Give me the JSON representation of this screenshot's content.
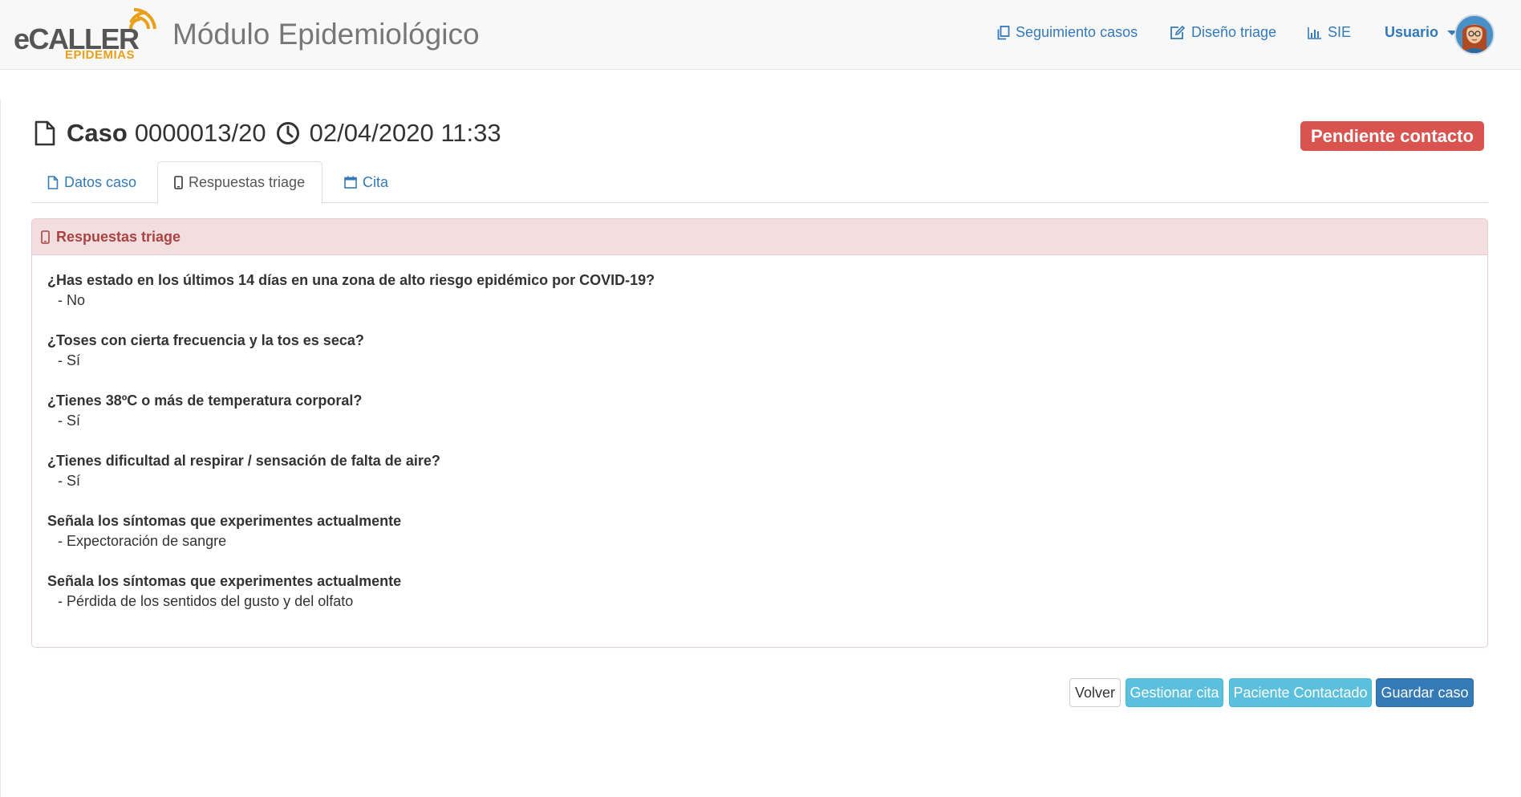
{
  "navbar": {
    "logo": {
      "main": "eCALLER",
      "sub": "EPIDEMIAS"
    },
    "app_title": "Módulo Epidemiológico",
    "links": {
      "seguimiento": "Seguimiento casos",
      "diseno": "Diseño triage",
      "sie": "SIE",
      "usuario": "Usuario"
    },
    "icons": {
      "seguimiento": "copy-icon",
      "diseno": "edit-icon",
      "sie": "bar-chart-icon",
      "usuario": "user-avatar"
    }
  },
  "case": {
    "label": "Caso",
    "number": "0000013/20",
    "datetime": "02/04/2020 11:33",
    "status": "Pendiente contacto"
  },
  "tabs": [
    {
      "label": "Datos caso",
      "icon": "file-icon",
      "active": false
    },
    {
      "label": "Respuestas triage",
      "icon": "mobile-icon",
      "active": true
    },
    {
      "label": "Cita",
      "icon": "calendar-icon",
      "active": false
    }
  ],
  "panel": {
    "title": "Respuestas triage",
    "items": [
      {
        "question": "¿Has estado en los últimos 14 días en una zona de alto riesgo epidémico por COVID-19?",
        "answer": "- No"
      },
      {
        "question": "¿Toses con cierta frecuencia y la tos es seca?",
        "answer": "- Sí"
      },
      {
        "question": "¿Tienes 38ºC o más de temperatura corporal?",
        "answer": "- Sí"
      },
      {
        "question": "¿Tienes dificultad al respirar / sensación de falta de aire?",
        "answer": "- Sí"
      },
      {
        "question": "Señala los síntomas que experimentes actualmente",
        "answer": "- Expectoración de sangre"
      },
      {
        "question": "Señala los síntomas que experimentes actualmente",
        "answer": "- Pérdida de los sentidos del gusto y del olfato"
      }
    ]
  },
  "actions": {
    "volver": "Volver",
    "gestionar": "Gestionar cita",
    "contactado": "Paciente Contactado",
    "guardar": "Guardar caso"
  },
  "colors": {
    "primary": "#337ab7",
    "info": "#5bc0de",
    "danger": "#d9534f",
    "panel_heading_bg": "#f2dede",
    "panel_heading_text": "#a94442",
    "logo_accent": "#e8a01a"
  }
}
